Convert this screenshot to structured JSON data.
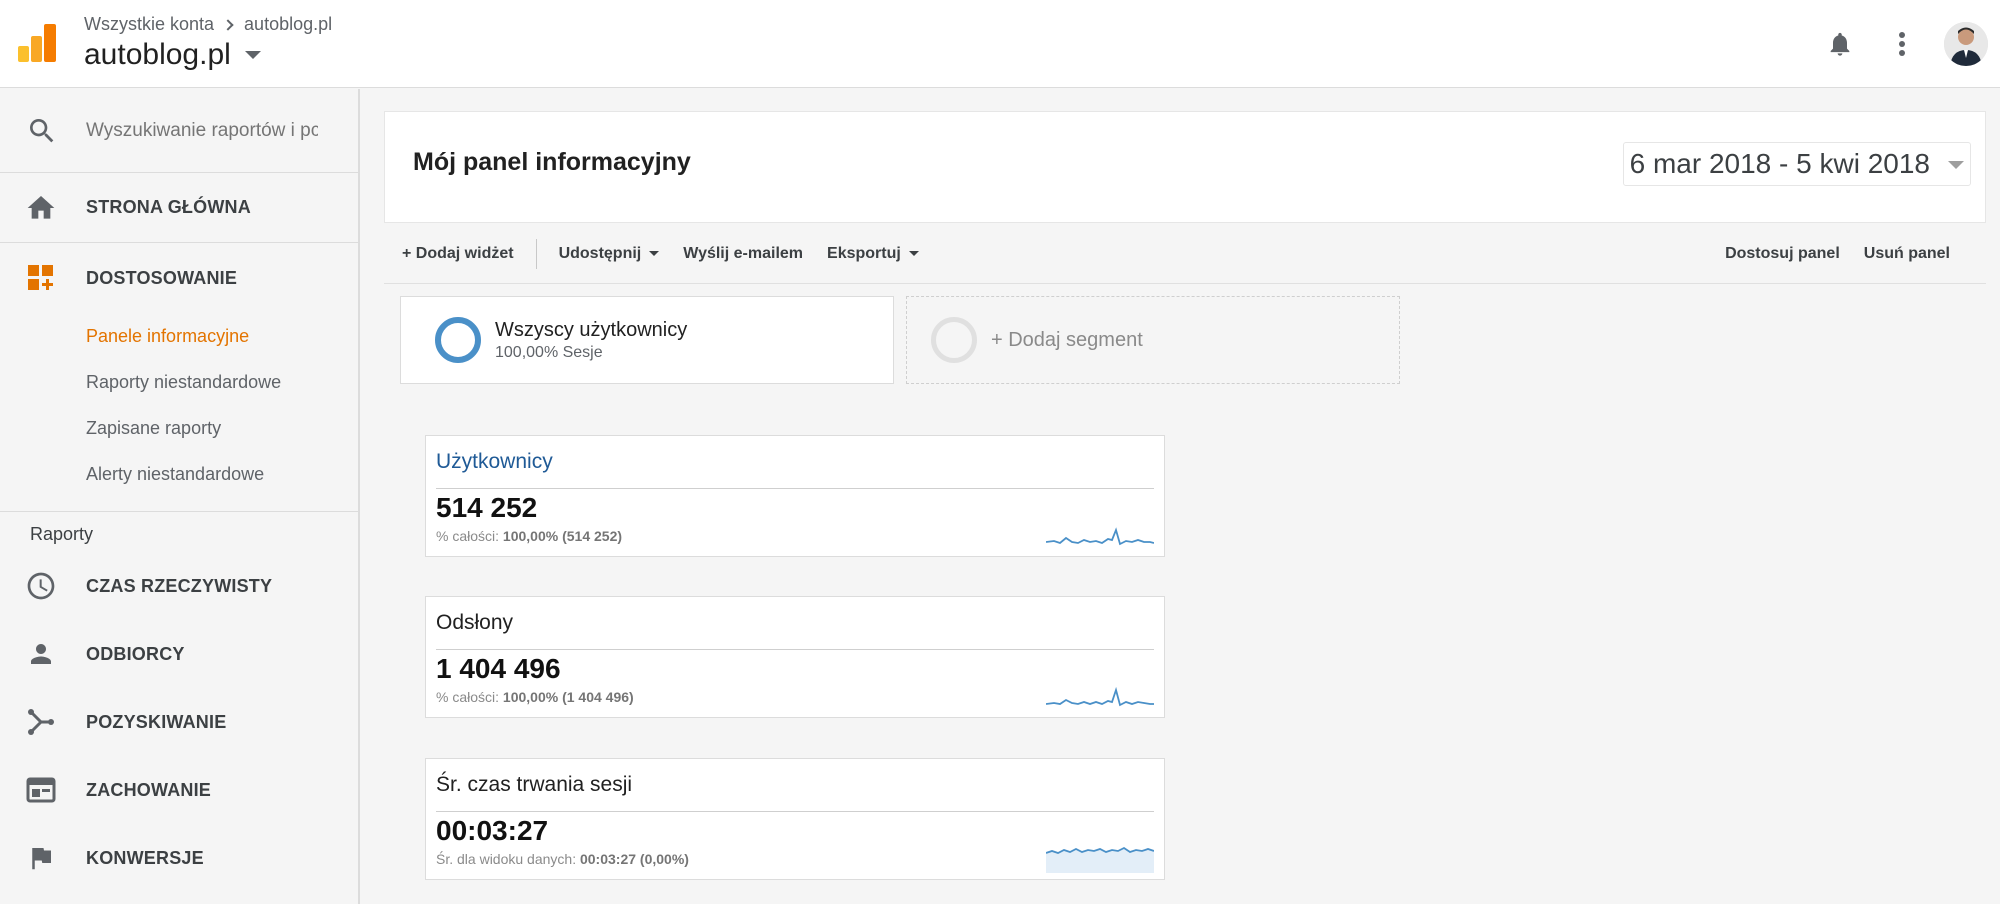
{
  "header": {
    "breadcrumb_root": "Wszystkie konta",
    "breadcrumb_child": "autoblog.pl",
    "property": "autoblog.pl",
    "icons": [
      "analytics-logo-icon",
      "bell-icon",
      "more-vert-icon",
      "avatar"
    ]
  },
  "sidebar": {
    "search_placeholder": "Wyszukiwanie raportów i pc",
    "home": "STRONA GŁÓWNA",
    "customization": "DOSTOSOWANIE",
    "sub_items": [
      "Panele informacyjne",
      "Raporty niestandardowe",
      "Zapisane raporty",
      "Alerty niestandardowe"
    ],
    "reports_title": "Raporty",
    "reports": [
      "CZAS RZECZYWISTY",
      "ODBIORCY",
      "POZYSKIWANIE",
      "ZACHOWANIE",
      "KONWERSJE"
    ]
  },
  "main": {
    "title": "Mój panel informacyjny",
    "date_range": "6 mar 2018 - 5 kwi 2018",
    "toolbar": {
      "add_widget": "+ Dodaj widżet",
      "share": "Udostępnij",
      "email": "Wyślij e-mailem",
      "export": "Eksportuj",
      "customize": "Dostosuj panel",
      "delete": "Usuń panel"
    },
    "segments": {
      "all_users_title": "Wszyscy użytkownicy",
      "all_users_sub": "100,00% Sesje",
      "add_segment": "+ Dodaj segment"
    },
    "widgets": [
      {
        "title": "Użytkownicy",
        "value": "514 252",
        "sub_label": "% całości:",
        "sub_value": "100,00% (514 252)"
      },
      {
        "title": "Odsłony",
        "value": "1 404 496",
        "sub_label": "% całości:",
        "sub_value": "100,00% (1 404 496)"
      },
      {
        "title": "Śr. czas trwania sesji",
        "value": "00:03:27",
        "sub_label": "Śr. dla widoku danych:",
        "sub_value": "00:03:27 (0,00%)"
      }
    ]
  },
  "colors": {
    "accent_orange": "#e37400",
    "link_blue": "#1f5a96",
    "segment_blue": "#4a90c8",
    "sparkline": "#4a90c8"
  }
}
